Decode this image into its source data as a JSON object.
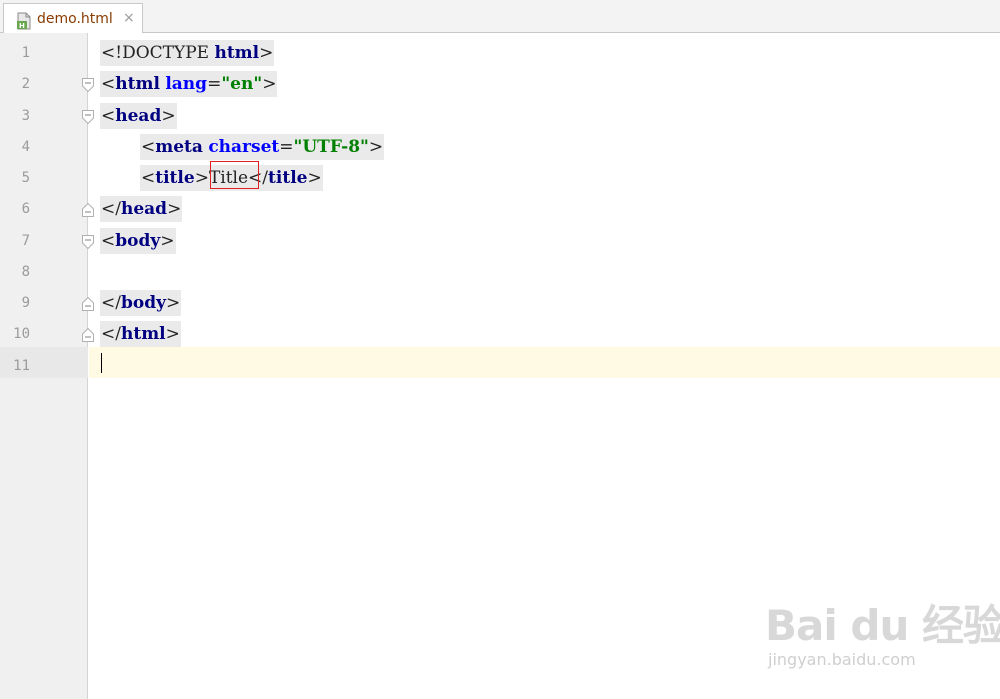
{
  "tab": {
    "filename": "demo.html",
    "close_glyph": "×",
    "icon": "html-file-icon"
  },
  "editor": {
    "line_numbers": [
      "1",
      "2",
      "3",
      "4",
      "5",
      "6",
      "7",
      "8",
      "9",
      "10",
      "11"
    ],
    "lines": [
      [
        {
          "c": "p",
          "t": "<!DOCTYPE "
        },
        {
          "c": "t",
          "t": "html"
        },
        {
          "c": "p",
          "t": ">"
        }
      ],
      [
        {
          "c": "p",
          "t": "<"
        },
        {
          "c": "t",
          "t": "html"
        },
        {
          "c": "p",
          "t": " "
        },
        {
          "c": "a",
          "t": "lang"
        },
        {
          "c": "p",
          "t": "="
        },
        {
          "c": "s",
          "t": "\"en\""
        },
        {
          "c": "p",
          "t": ">"
        }
      ],
      [
        {
          "c": "p",
          "t": "<"
        },
        {
          "c": "t",
          "t": "head"
        },
        {
          "c": "p",
          "t": ">"
        }
      ],
      [
        {
          "c": "p",
          "t": "<"
        },
        {
          "c": "t",
          "t": "meta"
        },
        {
          "c": "p",
          "t": " "
        },
        {
          "c": "a",
          "t": "charset"
        },
        {
          "c": "p",
          "t": "="
        },
        {
          "c": "s",
          "t": "\"UTF-8\""
        },
        {
          "c": "p",
          "t": ">"
        }
      ],
      [
        {
          "c": "p",
          "t": "<"
        },
        {
          "c": "t",
          "t": "title"
        },
        {
          "c": "p",
          "t": ">"
        },
        {
          "c": "txt",
          "t": "Title"
        },
        {
          "c": "p",
          "t": "</"
        },
        {
          "c": "t",
          "t": "title"
        },
        {
          "c": "p",
          "t": ">"
        }
      ],
      [
        {
          "c": "p",
          "t": "</"
        },
        {
          "c": "t",
          "t": "head"
        },
        {
          "c": "p",
          "t": ">"
        }
      ],
      [
        {
          "c": "p",
          "t": "<"
        },
        {
          "c": "t",
          "t": "body"
        },
        {
          "c": "p",
          "t": ">"
        }
      ],
      [],
      [
        {
          "c": "p",
          "t": "</"
        },
        {
          "c": "t",
          "t": "body"
        },
        {
          "c": "p",
          "t": ">"
        }
      ],
      [
        {
          "c": "p",
          "t": "</"
        },
        {
          "c": "t",
          "t": "html"
        },
        {
          "c": "p",
          "t": ">"
        }
      ],
      []
    ],
    "current_line": "11",
    "highlighted_text": "Title",
    "colors": {
      "tag": "#000080",
      "attribute": "#0000ff",
      "string": "#008000",
      "highlight_border": "#e02020",
      "current_line_bg": "#fffae3"
    }
  },
  "watermark": {
    "brand": "Bai du 经验",
    "url": "jingyan.baidu.com"
  }
}
